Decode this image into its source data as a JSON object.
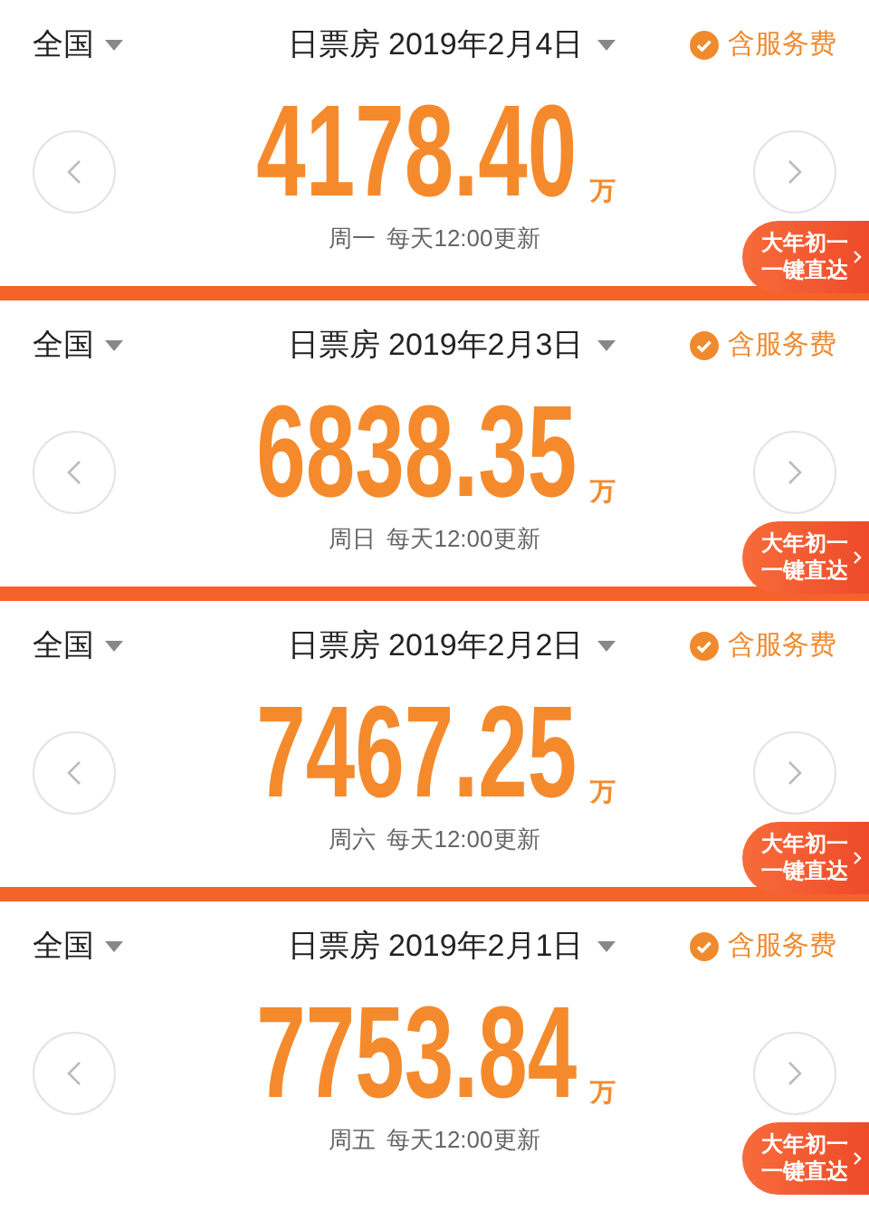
{
  "panels": [
    {
      "region": "全国",
      "title": "日票房 2019年2月4日",
      "fee": {
        "label": "含服务费",
        "checked": true
      },
      "amount": "4178.40",
      "unit": "万",
      "weekday": "周一",
      "note": "每天12:00更新",
      "promo": [
        "大年初一",
        "一键直达"
      ]
    },
    {
      "region": "全国",
      "title": "日票房 2019年2月3日",
      "fee": {
        "label": "含服务费",
        "checked": true
      },
      "amount": "6838.35",
      "unit": "万",
      "weekday": "周日",
      "note": "每天12:00更新",
      "promo": [
        "大年初一",
        "一键直达"
      ]
    },
    {
      "region": "全国",
      "title": "日票房 2019年2月2日",
      "fee": {
        "label": "含服务费",
        "checked": true
      },
      "amount": "7467.25",
      "unit": "万",
      "weekday": "周六",
      "note": "每天12:00更新",
      "promo": [
        "大年初一",
        "一键直达"
      ]
    },
    {
      "region": "全国",
      "title": "日票房 2019年2月1日",
      "fee": {
        "label": "含服务费",
        "checked": true
      },
      "amount": "7753.84",
      "unit": "万",
      "weekday": "周五",
      "note": "每天12:00更新",
      "promo": [
        "大年初一",
        "一键直达"
      ]
    }
  ]
}
